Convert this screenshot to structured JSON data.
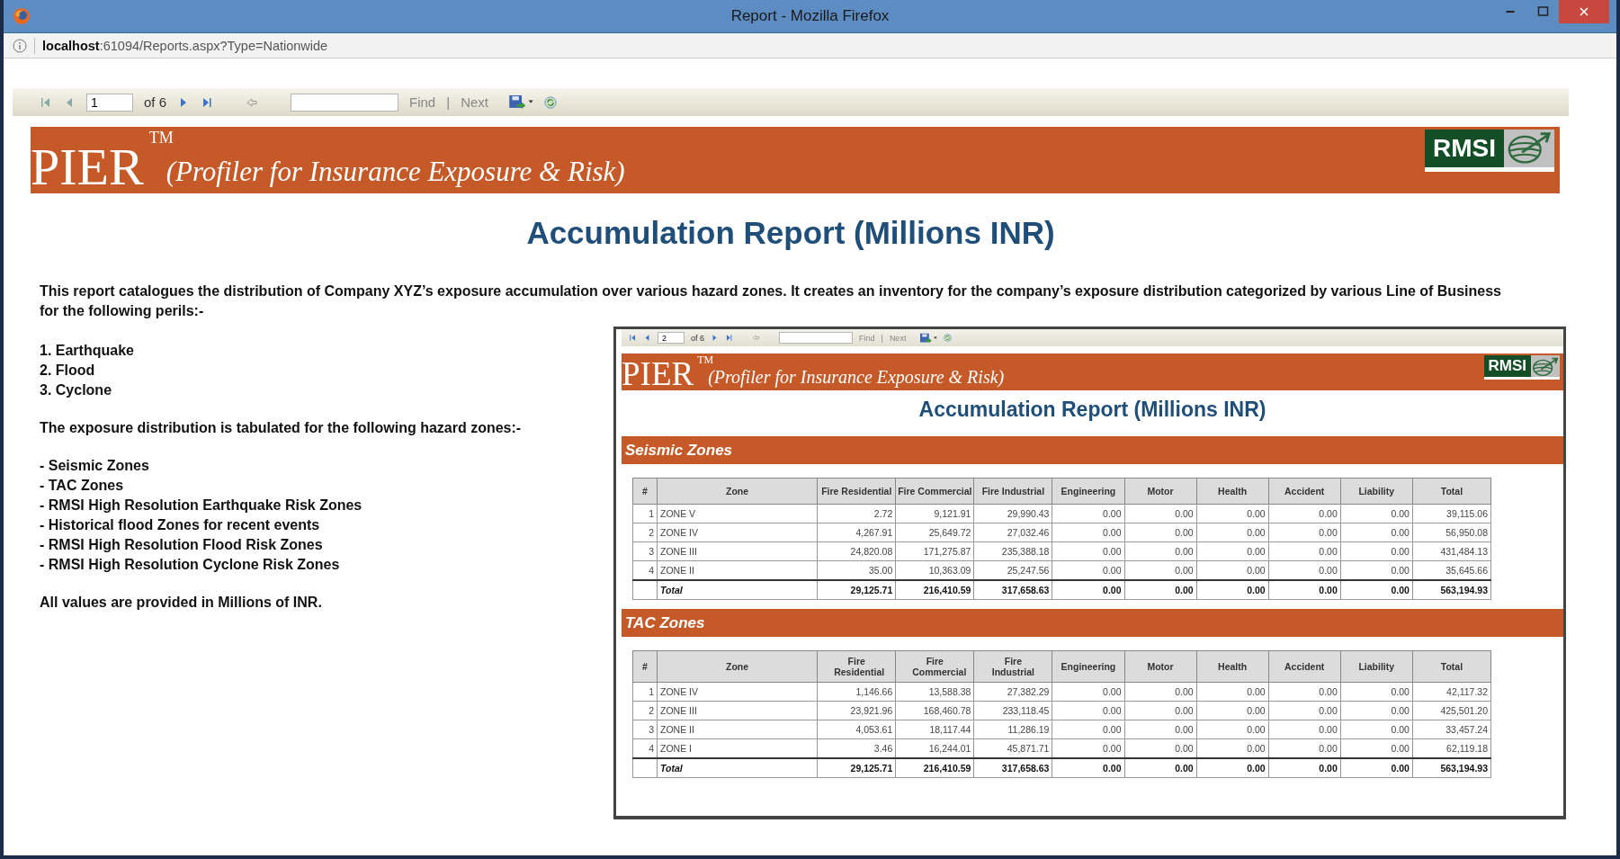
{
  "window": {
    "title": "Report - Mozilla Firefox"
  },
  "address_bar": {
    "url": "**localhost**:61094/Reports.aspx?Type=Nationwide"
  },
  "toolbar": {
    "page": "1",
    "page_count": "of 6",
    "find": "Find",
    "separator": "|",
    "next": "Next"
  },
  "banner": {
    "logo": "PIER",
    "trademark": "TM",
    "subtitle": "(Profiler for Insurance Exposure & Risk)",
    "brand": "RMSI"
  },
  "report_title": "Accumulation Report (Millions INR)",
  "intro": "This report catalogues the distribution of Company XYZ’s exposure accumulation over various hazard zones. It creates an inventory for the company’s exposure distribution categorized by various Line of Business for the following perils:-",
  "perils": [
    "1. Earthquake",
    "2. Flood",
    "3. Cyclone"
  ],
  "zones_intro": "The exposure distribution is tabulated for the following hazard zones:-",
  "zones": [
    "- Seismic Zones",
    "- TAC Zones",
    "- RMSI High Resolution Earthquake Risk Zones",
    "- Historical flood Zones for recent events",
    "- RMSI High Resolution Flood Risk Zones",
    "- RMSI High Resolution Cyclone Risk Zones"
  ],
  "note": "All values are provided in Millions of INR.",
  "preview": {
    "toolbar": {
      "page": "2",
      "page_count": "of 6",
      "find": "Find",
      "separator": "|",
      "next": "Next"
    },
    "banner": {
      "logo": "PIER",
      "trademark": "TM",
      "subtitle": "(Profiler for Insurance Exposure & Risk)",
      "brand": "RMSI"
    },
    "report_title": "Accumulation Report (Millions INR)",
    "sections": [
      {
        "title": "Seismic Zones",
        "columns": [
          "#",
          "Zone",
          "Fire Residential",
          "Fire Commercial",
          "Fire Industrial",
          "Engineering",
          "Motor",
          "Health",
          "Accident",
          "Liability",
          "Total"
        ],
        "rows": [
          {
            "number": "1",
            "zone": "ZONE V",
            "values": [
              "2.72",
              "9,121.91",
              "29,990.43",
              "0.00",
              "0.00",
              "0.00",
              "0.00",
              "0.00",
              "39,115.06"
            ]
          },
          {
            "number": "2",
            "zone": "ZONE IV",
            "values": [
              "4,267.91",
              "25,649.72",
              "27,032.46",
              "0.00",
              "0.00",
              "0.00",
              "0.00",
              "0.00",
              "56,950.08"
            ]
          },
          {
            "number": "3",
            "zone": "ZONE III",
            "values": [
              "24,820.08",
              "171,275.87",
              "235,388.18",
              "0.00",
              "0.00",
              "0.00",
              "0.00",
              "0.00",
              "431,484.13"
            ]
          },
          {
            "number": "4",
            "zone": "ZONE II",
            "values": [
              "35.00",
              "10,363.09",
              "25,247.56",
              "0.00",
              "0.00",
              "0.00",
              "0.00",
              "0.00",
              "35,645.66"
            ]
          }
        ],
        "total": {
          "label": "Total",
          "values": [
            "29,125.71",
            "216,410.59",
            "317,658.63",
            "0.00",
            "0.00",
            "0.00",
            "0.00",
            "0.00",
            "563,194.93"
          ]
        }
      },
      {
        "title": "TAC Zones",
        "columns": [
          "#",
          "Zone",
          "Fire Residential",
          "Fire Commercial",
          "Fire Industrial",
          "Engineering",
          "Motor",
          "Health",
          "Accident",
          "Liability",
          "Total"
        ],
        "rows": [
          {
            "number": "1",
            "zone": "ZONE IV",
            "values": [
              "1,146.66",
              "13,588.38",
              "27,382.29",
              "0.00",
              "0.00",
              "0.00",
              "0.00",
              "0.00",
              "42,117.32"
            ]
          },
          {
            "number": "2",
            "zone": "ZONE III",
            "values": [
              "23,921.96",
              "168,460.78",
              "233,118.45",
              "0.00",
              "0.00",
              "0.00",
              "0.00",
              "0.00",
              "425,501.20"
            ]
          },
          {
            "number": "3",
            "zone": "ZONE II",
            "values": [
              "4,053.61",
              "18,117.44",
              "11,286.19",
              "0.00",
              "0.00",
              "0.00",
              "0.00",
              "0.00",
              "33,457.24"
            ]
          },
          {
            "number": "4",
            "zone": "ZONE I",
            "values": [
              "3.46",
              "16,244.01",
              "45,871.71",
              "0.00",
              "0.00",
              "0.00",
              "0.00",
              "0.00",
              "62,119.18"
            ]
          }
        ],
        "total": {
          "label": "Total",
          "values": [
            "29,125.71",
            "216,410.59",
            "317,658.63",
            "0.00",
            "0.00",
            "0.00",
            "0.00",
            "0.00",
            "563,194.93"
          ]
        }
      }
    ]
  }
}
